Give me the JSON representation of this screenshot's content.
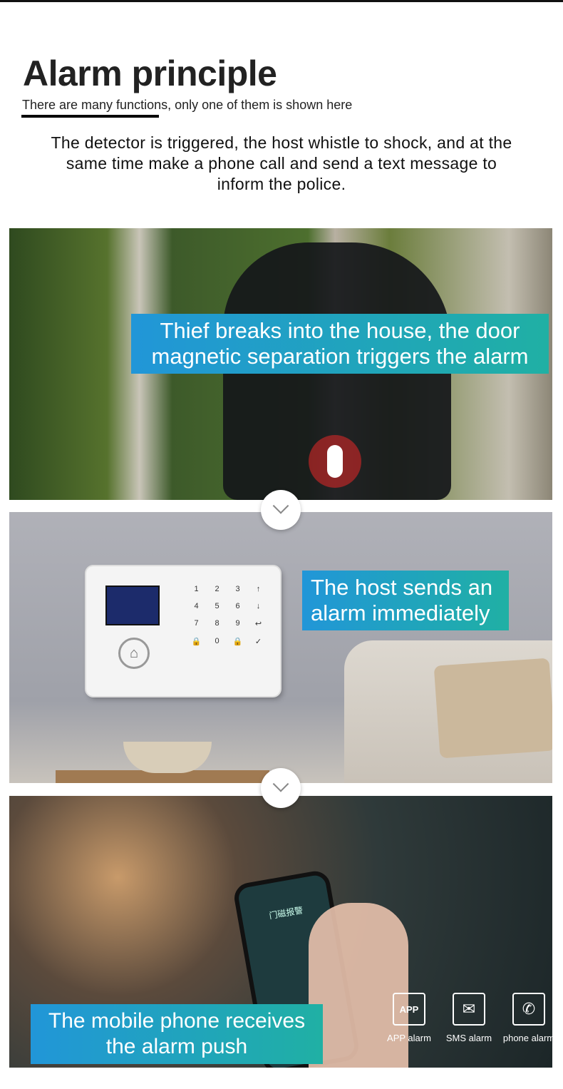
{
  "header": {
    "title": "Alarm principle",
    "subtitle": "There are many functions, only one of them is shown here"
  },
  "description": "The detector is triggered, the host whistle to shock, and at the same time make a phone call and send a text message to inform the police.",
  "steps": [
    {
      "caption": "Thief breaks into the house, the door magnetic separation triggers the alarm"
    },
    {
      "caption": "The host sends an alarm immediately"
    },
    {
      "caption": "The mobile phone receives the alarm push",
      "phone_screen": "门磁报警"
    }
  ],
  "host_keys": [
    "1",
    "2",
    "3",
    "↑",
    "4",
    "5",
    "6",
    "↓",
    "7",
    "8",
    "9",
    "↩",
    "🔒",
    "0",
    "🔒",
    "✓"
  ],
  "alarm_types": [
    {
      "icon": "app-icon",
      "label": "APP alarm"
    },
    {
      "icon": "envelope-icon",
      "label": "SMS alarm"
    },
    {
      "icon": "phone-icon",
      "label": "phone alarm"
    }
  ],
  "colors": {
    "caption_start": "#2196d8",
    "caption_end": "#20b0a4"
  }
}
